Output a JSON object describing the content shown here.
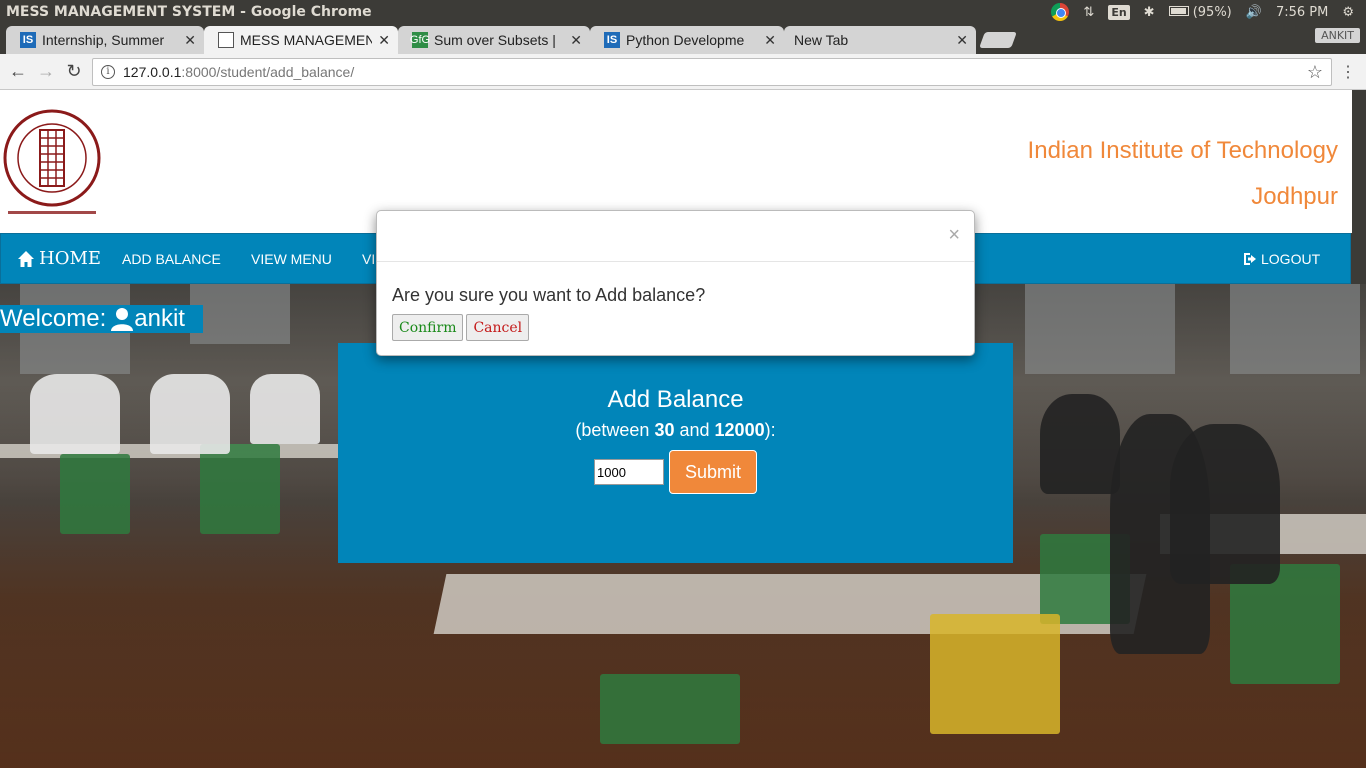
{
  "os": {
    "window_title": "MESS MANAGEMENT SYSTEM - Google Chrome",
    "battery": "(95%)",
    "time": "7:56 PM",
    "keyboard": "En",
    "profile": "ANKIT"
  },
  "tabs": [
    {
      "label": "Internship, Summer",
      "icon": "IS"
    },
    {
      "label": "MESS MANAGEMEN",
      "icon": "doc"
    },
    {
      "label": "Sum over Subsets |",
      "icon": "GfG"
    },
    {
      "label": "Python Developme",
      "icon": "IS"
    },
    {
      "label": "New Tab",
      "icon": ""
    }
  ],
  "address": {
    "host": "127.0.0.1",
    "path": ":8000/student/add_balance/"
  },
  "header": {
    "institute_line1": "Indian Institute of Technology",
    "institute_line2": "Jodhpur"
  },
  "nav": {
    "home": "HOME",
    "add_balance": "ADD BALANCE",
    "view_menu": "VIEW MENU",
    "partial_item": "VI",
    "logout": "LOGOUT"
  },
  "welcome": {
    "prefix": "Welcome: ",
    "user": "ankit"
  },
  "panel": {
    "title": "Add Balance",
    "sub_prefix": "(between ",
    "min": "30",
    "and": " and ",
    "max": "12000",
    "sub_suffix": "):",
    "amount_value": "1000",
    "submit_label": "Submit"
  },
  "modal": {
    "close": "×",
    "message": "Are you sure you want to Add balance?",
    "confirm_label": "Confirm",
    "cancel_label": "Cancel"
  },
  "colors": {
    "brand_blue": "#0185b9",
    "accent_orange": "#f0883a"
  }
}
